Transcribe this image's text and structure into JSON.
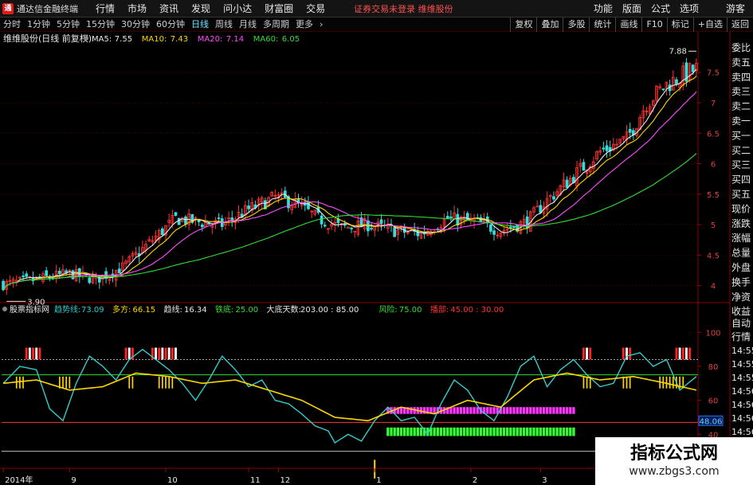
{
  "window": {
    "title": "通达信金融终端",
    "logo_glyph": "通"
  },
  "menu": [
    "行情",
    "市场",
    "资讯",
    "发现",
    "问小达",
    "财富圈",
    "交易"
  ],
  "notice": "证券交易未登录  维维股份",
  "right_menu": [
    "功能",
    "版面",
    "公式",
    "选项"
  ],
  "user": "游客",
  "periods": [
    {
      "label": "分时",
      "active": false
    },
    {
      "label": "1分钟",
      "active": false
    },
    {
      "label": "5分钟",
      "active": false
    },
    {
      "label": "15分钟",
      "active": false
    },
    {
      "label": "30分钟",
      "active": false
    },
    {
      "label": "60分钟",
      "active": false
    },
    {
      "label": "日线",
      "active": true
    },
    {
      "label": "周线",
      "active": false
    },
    {
      "label": "月线",
      "active": false
    },
    {
      "label": "多周期",
      "active": false
    },
    {
      "label": "更多",
      "active": false
    },
    {
      "label": "›",
      "active": false
    }
  ],
  "toolbar": [
    "复权",
    "叠加",
    "多股",
    "统计",
    "画线",
    "F10",
    "标记",
    "+自选",
    "返回"
  ],
  "main_panel": {
    "stock_label": "维维股份(日线 前复权)",
    "ma": [
      {
        "label": "MA5:",
        "value": "7.55",
        "color": "#e8e8e8"
      },
      {
        "label": "MA10:",
        "value": "7.43",
        "color": "#ffd700"
      },
      {
        "label": "MA20:",
        "value": "7.14",
        "color": "#ff4dff"
      },
      {
        "label": "MA60:",
        "value": "6.05",
        "color": "#33dd33"
      }
    ],
    "high_mark": "7.88",
    "low_mark": "3.90"
  },
  "indicator_panel": {
    "name": "股票指标网",
    "items": [
      {
        "label": "趋势线:",
        "value": "73.09",
        "color": "#33cccc"
      },
      {
        "label": "多方:",
        "value": "66.15",
        "color": "#ffd700"
      },
      {
        "label": "趋线:",
        "value": "16.34",
        "color": "#e8e8e8"
      },
      {
        "label": "铁底:",
        "value": "25.00",
        "color": "#33dd33"
      },
      {
        "label": "大底天数:",
        "value": "203.00 : 85.00",
        "color": "#e8e8e8"
      },
      {
        "label": "风险:",
        "value": "75.00",
        "color": "#33dd33"
      },
      {
        "label": "播部:",
        "value": "45.00 : 30.00",
        "color": "#ff3333"
      }
    ],
    "current_value": "48.06"
  },
  "right_side": [
    "委比",
    "卖五",
    "卖四",
    "卖三",
    "卖二",
    "卖一",
    "买一",
    "买二",
    "买三",
    "买四",
    "买五",
    "现价",
    "涨跌",
    "涨幅",
    "总量",
    "外盘",
    "换手",
    "净资",
    "收益"
  ],
  "right_side_lower": [
    "自动",
    "行情"
  ],
  "times": [
    "14:55",
    "14:55",
    "14:55",
    "14:56",
    "14:56",
    "14:56",
    "14:56",
    "14:56",
    "14:56"
  ],
  "colors": {
    "up": "#ff3333",
    "down": "#33dddd",
    "grid": "#5a0000"
  },
  "chart_data": [
    {
      "type": "candlestick",
      "title": "维维股份(日线 前复权)",
      "y_ticks": [
        4.0,
        4.5,
        5.0,
        5.5,
        6.0,
        6.5,
        7.0,
        7.5
      ],
      "ylim": [
        3.72,
        7.98
      ],
      "n_bars": 210,
      "series": [
        {
          "name": "MA5",
          "type": "line",
          "color": "#e8e8e8"
        },
        {
          "name": "MA10",
          "type": "line",
          "color": "#ffd700"
        },
        {
          "name": "MA20",
          "type": "line",
          "color": "#ff4dff"
        },
        {
          "name": "MA60",
          "type": "line",
          "color": "#33dd33"
        }
      ],
      "close_anchors": [
        [
          0,
          4.02
        ],
        [
          10,
          4.1
        ],
        [
          20,
          4.2
        ],
        [
          28,
          4.1
        ],
        [
          36,
          4.3
        ],
        [
          44,
          4.7
        ],
        [
          52,
          5.1
        ],
        [
          58,
          5.05
        ],
        [
          66,
          5.0
        ],
        [
          74,
          5.25
        ],
        [
          82,
          5.45
        ],
        [
          88,
          5.35
        ],
        [
          95,
          5.1
        ],
        [
          102,
          4.95
        ],
        [
          110,
          5.0
        ],
        [
          118,
          4.9
        ],
        [
          126,
          4.85
        ],
        [
          134,
          5.1
        ],
        [
          142,
          5.05
        ],
        [
          150,
          4.9
        ],
        [
          158,
          5.05
        ],
        [
          164,
          5.4
        ],
        [
          172,
          5.8
        ],
        [
          180,
          6.2
        ],
        [
          188,
          6.4
        ],
        [
          194,
          7.0
        ],
        [
          200,
          7.3
        ],
        [
          205,
          7.45
        ],
        [
          209,
          7.55
        ]
      ],
      "x_labels": [
        {
          "label": "2014年",
          "bar": 0
        },
        {
          "label": "9",
          "bar": 20
        },
        {
          "label": "10",
          "bar": 49
        },
        {
          "label": "11",
          "bar": 74
        },
        {
          "label": "12",
          "bar": 83
        },
        {
          "label": "1",
          "bar": 112
        },
        {
          "label": "2",
          "bar": 141
        },
        {
          "label": "3",
          "bar": 162
        }
      ]
    },
    {
      "type": "line",
      "title": "股票指标网",
      "y_ticks": [
        40.0,
        60.0,
        80.0,
        100.0
      ],
      "ylim": [
        20,
        110
      ],
      "series": [
        {
          "name": "趋势线",
          "color": "#33cccc",
          "anchors": [
            [
              0,
              70
            ],
            [
              5,
              80
            ],
            [
              10,
              78
            ],
            [
              14,
              55
            ],
            [
              18,
              48
            ],
            [
              22,
              70
            ],
            [
              26,
              86
            ],
            [
              30,
              80
            ],
            [
              34,
              72
            ],
            [
              38,
              84
            ],
            [
              42,
              90
            ],
            [
              46,
              84
            ],
            [
              50,
              78
            ],
            [
              54,
              70
            ],
            [
              58,
              60
            ],
            [
              62,
              72
            ],
            [
              66,
              86
            ],
            [
              70,
              78
            ],
            [
              74,
              68
            ],
            [
              78,
              72
            ],
            [
              82,
              60
            ],
            [
              86,
              58
            ],
            [
              90,
              52
            ],
            [
              94,
              45
            ],
            [
              98,
              42
            ],
            [
              100,
              35
            ],
            [
              104,
              40
            ],
            [
              108,
              36
            ],
            [
              112,
              48
            ],
            [
              116,
              56
            ],
            [
              120,
              48
            ],
            [
              124,
              50
            ],
            [
              128,
              40
            ],
            [
              132,
              58
            ],
            [
              136,
              72
            ],
            [
              140,
              66
            ],
            [
              144,
              54
            ],
            [
              148,
              48
            ],
            [
              152,
              62
            ],
            [
              156,
              80
            ],
            [
              160,
              86
            ],
            [
              164,
              68
            ],
            [
              168,
              78
            ],
            [
              172,
              84
            ],
            [
              176,
              75
            ],
            [
              180,
              68
            ],
            [
              184,
              70
            ],
            [
              188,
              86
            ],
            [
              192,
              88
            ],
            [
              196,
              80
            ],
            [
              200,
              84
            ],
            [
              204,
              66
            ],
            [
              209,
              74
            ]
          ]
        },
        {
          "name": "多方",
          "color": "#ffd700",
          "anchors": [
            [
              0,
              70
            ],
            [
              10,
              72
            ],
            [
              20,
              66
            ],
            [
              30,
              68
            ],
            [
              40,
              76
            ],
            [
              50,
              74
            ],
            [
              60,
              70
            ],
            [
              70,
              72
            ],
            [
              80,
              66
            ],
            [
              90,
              60
            ],
            [
              100,
              50
            ],
            [
              110,
              48
            ],
            [
              120,
              56
            ],
            [
              130,
              52
            ],
            [
              140,
              60
            ],
            [
              150,
              56
            ],
            [
              160,
              72
            ],
            [
              170,
              76
            ],
            [
              180,
              72
            ],
            [
              190,
              74
            ],
            [
              200,
              70
            ],
            [
              209,
              66
            ]
          ]
        }
      ],
      "hlines": [
        {
          "value": 84,
          "color": "#aaaaaa",
          "dashed": true
        },
        {
          "value": 75,
          "color": "#33dd33",
          "dashed": false
        },
        {
          "value": 47,
          "color": "#ff3333",
          "dashed": false
        },
        {
          "value": 30,
          "color": "#bbbbbb",
          "dashed": false
        }
      ],
      "sell_signal_bars": [
        7,
        8,
        9,
        10,
        11,
        37,
        38,
        39,
        45,
        46,
        47,
        48,
        49,
        50,
        51,
        52,
        175,
        176,
        177,
        187,
        188,
        189,
        203,
        204,
        205,
        206,
        207
      ],
      "buy_signal_bars": [
        4,
        5,
        6,
        17,
        18,
        19,
        20,
        38,
        39,
        44,
        45,
        46,
        47,
        48,
        49,
        50,
        51,
        52,
        53,
        54,
        55,
        56,
        57,
        58,
        59,
        60,
        61,
        62,
        63,
        64,
        65,
        66,
        67,
        68,
        69,
        70,
        71,
        72,
        73,
        74,
        75,
        76,
        77,
        78,
        79,
        80,
        81,
        82,
        83,
        84,
        85,
        86,
        87,
        88,
        89,
        90,
        91,
        92,
        93,
        94,
        95,
        96,
        97,
        98,
        99,
        100,
        101,
        102,
        103,
        104,
        105,
        106,
        107,
        108,
        109,
        110,
        111,
        112,
        113,
        114,
        115,
        116,
        117,
        118,
        119,
        120,
        121,
        122,
        123,
        124,
        125,
        126,
        127,
        128,
        129,
        130,
        131,
        132,
        133,
        134,
        135,
        136,
        137,
        138,
        139,
        140,
        141,
        142,
        143,
        144,
        145,
        146,
        147,
        148,
        149,
        150,
        151,
        152,
        153,
        154,
        155,
        156,
        157,
        158,
        159,
        160,
        161,
        162,
        163,
        164,
        165,
        166,
        167,
        168,
        169,
        170,
        171,
        172,
        173,
        174,
        175,
        176,
        177,
        178,
        179,
        180,
        181,
        182,
        183,
        184,
        185,
        186,
        187,
        188,
        189,
        190,
        191,
        192,
        193,
        194,
        195,
        196,
        197,
        198,
        199,
        200,
        201,
        202,
        203,
        204,
        205,
        206,
        207
      ],
      "magenta_zone": {
        "from_bar": 116,
        "to_bar": 172,
        "from": 52,
        "to": 56
      },
      "green_zone": {
        "from_bar": 116,
        "to_bar": 172,
        "from": 39,
        "to": 44
      }
    }
  ],
  "watermark": {
    "title": "指标公式网",
    "url": "www.zbgs3.com"
  }
}
